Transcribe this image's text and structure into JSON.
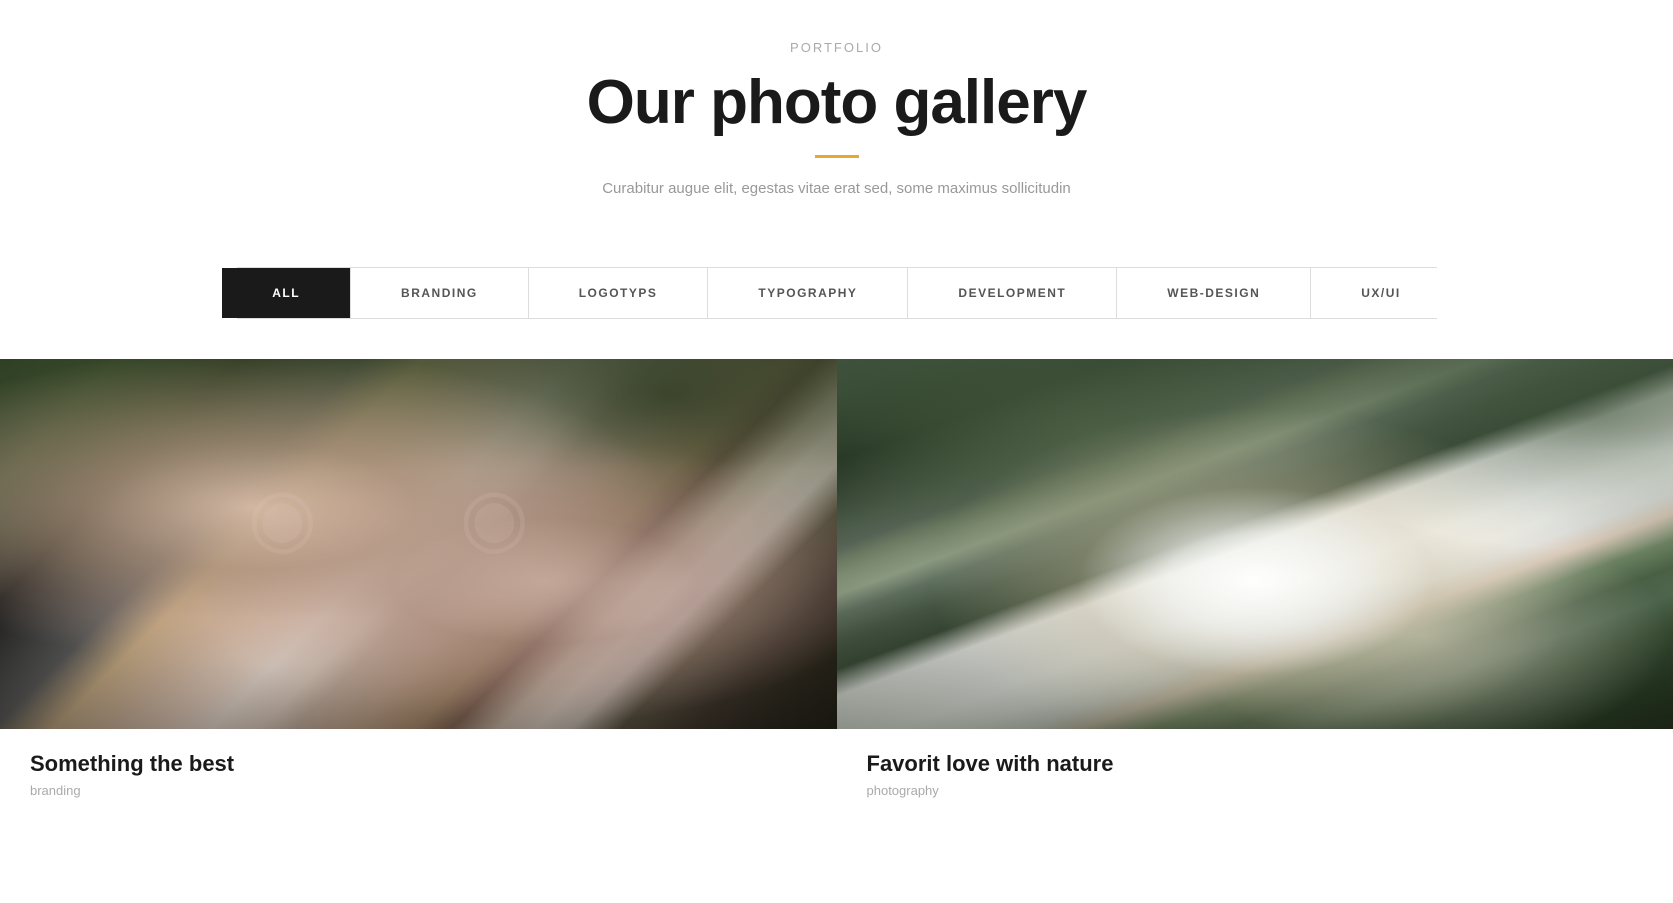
{
  "header": {
    "portfolio_label": "PORTFOLIO",
    "gallery_title": "Our photo gallery",
    "subtitle": "Curabitur augue elit, egestas vitae erat sed, some maximus sollicitudin",
    "accent_color": "#e8a830"
  },
  "filter_tabs": {
    "items": [
      {
        "id": "all",
        "label": "ALL",
        "active": true
      },
      {
        "id": "branding",
        "label": "BRANDING",
        "active": false
      },
      {
        "id": "logotyps",
        "label": "LOGOTYPS",
        "active": false
      },
      {
        "id": "typography",
        "label": "TYPOGRAPHY",
        "active": false
      },
      {
        "id": "development",
        "label": "DEVELOPMENT",
        "active": false
      },
      {
        "id": "web-design",
        "label": "WEB-DESIGN",
        "active": false
      },
      {
        "id": "ux-ui",
        "label": "UX/UI",
        "active": false
      }
    ]
  },
  "gallery": {
    "items": [
      {
        "id": "item1",
        "title": "Something the best",
        "category": "branding",
        "alt": "Two women with white hair lying down"
      },
      {
        "id": "item2",
        "title": "Favorit love with nature",
        "category": "photography",
        "alt": "Woman in white dress lying on hillside with white rabbit"
      }
    ]
  }
}
